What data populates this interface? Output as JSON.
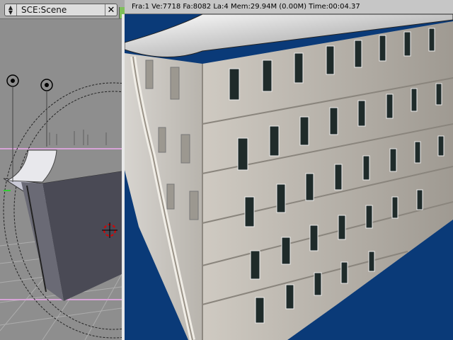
{
  "header": {
    "scene_label": "SCE:Scene",
    "scene_menu_icon": "up-down-arrows-icon",
    "close_icon": "close-icon"
  },
  "render_info": {
    "text": "Fra:1  Ve:7718 Fa:8082 La:4 Mem:29.94M (0.00M) Time:00:04.37"
  },
  "colors": {
    "viewport_bg": "#8e8e8e",
    "render_bg": "#0a3a78",
    "selection_green": "#7fbf5a"
  }
}
